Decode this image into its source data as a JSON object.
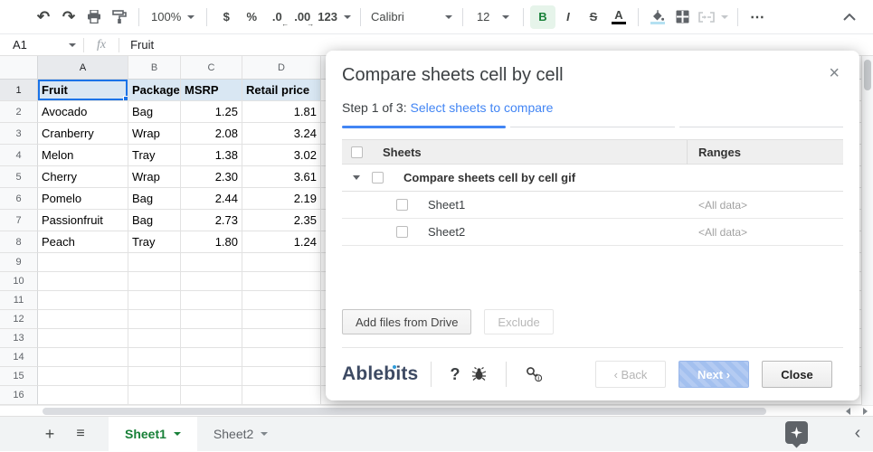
{
  "toolbar": {
    "undo": "↶",
    "redo": "↷",
    "zoom": "100%",
    "currency": "$",
    "percent": "%",
    "decrease_decimals": ".0",
    "increase_decimals": ".00",
    "decrease_arrow": "←",
    "increase_arrow": "→",
    "number_format": "123",
    "font": "Calibri",
    "font_size": "12",
    "bold": "B",
    "italic": "I",
    "strikethrough": "S",
    "text_color": "A",
    "more": "⋯"
  },
  "formula_bar": {
    "cell_ref": "A1",
    "fx": "fx",
    "content": "Fruit"
  },
  "sheet": {
    "col_headers": [
      "A",
      "B",
      "C",
      "D"
    ],
    "row_headers": [
      "1",
      "2",
      "3",
      "4",
      "5",
      "6",
      "7",
      "8",
      "9",
      "10",
      "11",
      "12",
      "13",
      "14",
      "15",
      "16"
    ],
    "data": {
      "headers": [
        "Fruit",
        "Package",
        "MSRP",
        "Retail price"
      ],
      "rows": [
        [
          "Avocado",
          "Bag",
          "1.25",
          "1.81"
        ],
        [
          "Cranberry",
          "Wrap",
          "2.08",
          "3.24"
        ],
        [
          "Melon",
          "Tray",
          "1.38",
          "3.02"
        ],
        [
          "Cherry",
          "Wrap",
          "2.30",
          "3.61"
        ],
        [
          "Pomelo",
          "Bag",
          "2.44",
          "2.19"
        ],
        [
          "Passionfruit",
          "Bag",
          "2.73",
          "2.35"
        ],
        [
          "Peach",
          "Tray",
          "1.80",
          "1.24"
        ]
      ]
    }
  },
  "dialog": {
    "title": "Compare sheets cell by cell",
    "close_icon": "×",
    "step_prefix": "Step 1 of 3:",
    "step_link": "Select sheets to compare",
    "table": {
      "sheets_header": "Sheets",
      "ranges_header": "Ranges",
      "group_label": "Compare sheets cell by cell gif",
      "rows": [
        {
          "name": "Sheet1",
          "range": "<All data>"
        },
        {
          "name": "Sheet2",
          "range": "<All data>"
        }
      ]
    },
    "actions": {
      "add_files": "Add files from Drive",
      "exclude": "Exclude"
    },
    "footer": {
      "brand": "Ablebits",
      "help": "?",
      "back": "‹ Back",
      "next": "Next ›",
      "close": "Close"
    }
  },
  "sheet_tabs": {
    "add": "+",
    "all_sheets": "≡",
    "tabs": [
      {
        "label": "Sheet1"
      },
      {
        "label": "Sheet2"
      }
    ]
  },
  "colors": {
    "accent_blue": "#4285f4",
    "selection_blue": "#1a73e8",
    "header_row_fill": "#d9e7f3",
    "active_tab_green": "#188038",
    "next_button_blue": "#a3c0ef"
  }
}
